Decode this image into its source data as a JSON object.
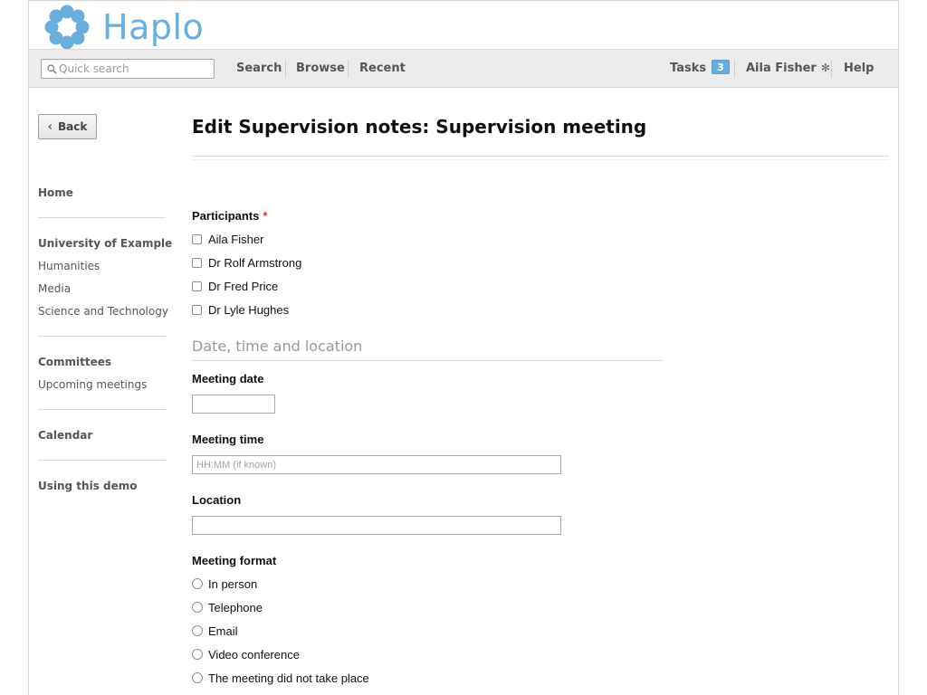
{
  "app": {
    "logo_text": "Haplo",
    "brand_color": "#6aaedd"
  },
  "navbar": {
    "search_placeholder": "Quick search",
    "links": {
      "search": "Search",
      "browse": "Browse",
      "recent": "Recent"
    },
    "tasks_label": "Tasks",
    "tasks_count": "3",
    "user_name": "Aila Fisher",
    "help_label": "Help"
  },
  "sidebar": {
    "back_label": "Back",
    "home": "Home",
    "org": "University of Example",
    "org_items": [
      "Humanities",
      "Media",
      "Science and Technology"
    ],
    "committees": "Committees",
    "committee_items": [
      "Upcoming meetings"
    ],
    "calendar": "Calendar",
    "demo": "Using this demo"
  },
  "main": {
    "title": "Edit Supervision notes: Supervision meeting",
    "participants_label": "Participants",
    "required_mark": "*",
    "participants": [
      "Aila Fisher",
      "Dr Rolf Armstrong",
      "Dr Fred Price",
      "Dr Lyle Hughes"
    ],
    "section_heading": "Date, time and location",
    "meeting_date_label": "Meeting date",
    "meeting_date_value": "",
    "meeting_time_label": "Meeting time",
    "meeting_time_placeholder": "HH:MM (if known)",
    "location_label": "Location",
    "location_value": "",
    "meeting_format_label": "Meeting format",
    "meeting_formats": [
      "In person",
      "Telephone",
      "Email",
      "Video conference",
      "The meeting did not take place"
    ]
  }
}
